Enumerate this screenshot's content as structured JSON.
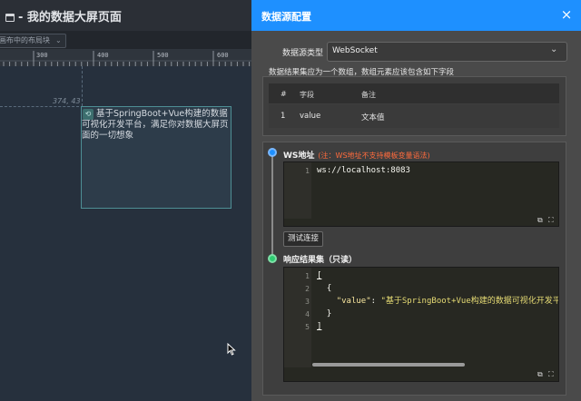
{
  "editor": {
    "title": "- 我的数据大屏页面",
    "layout_select": "画布中的布局块",
    "ruler_labels": [
      "300",
      "400",
      "500",
      "600"
    ],
    "coord": "374, 43",
    "widget_text": "基于SpringBoot+Vue构建的数据可视化开发平台，满足你对数据大屏页面的一切想象"
  },
  "drawer": {
    "title": "数据源配置",
    "close": "×",
    "ds_type_label": "数据源类型",
    "ds_type_value": "WebSocket",
    "result_note": "数据结果集应为一个数组，数组元素应该包含如下字段",
    "table": {
      "headers": [
        "#",
        "字段",
        "备注"
      ],
      "rows": [
        [
          "1",
          "value",
          "文本值"
        ]
      ]
    },
    "ws": {
      "label": "WS地址",
      "warning": "(注：WS地址不支持模板变量语法)",
      "line_no": "1",
      "url": "ws://localhost:8083"
    },
    "test_button": "测试连接",
    "response": {
      "label": "响应结果集（只读）",
      "line_nos": [
        "1",
        "2",
        "3",
        "4",
        "5"
      ],
      "open_bracket": "[",
      "open_brace": "{",
      "key": "\"value\"",
      "colon": ": ",
      "value": "\"基于SpringBoot+Vue构建的数据可视化开发平",
      "close_brace": "}",
      "close_bracket": "]"
    }
  },
  "colors": {
    "accent": "#1e90ff",
    "success": "#2ecc71",
    "warning": "#ff6b3d"
  }
}
